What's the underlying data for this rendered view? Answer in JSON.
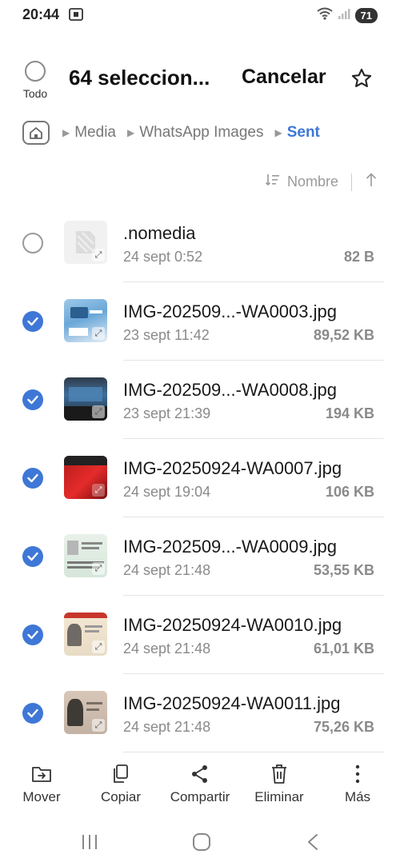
{
  "status_bar": {
    "time": "20:44",
    "battery": "71"
  },
  "header": {
    "select_all_label": "Todo",
    "title": "64 seleccion...",
    "cancel_label": "Cancelar"
  },
  "breadcrumb": {
    "items": [
      "Media",
      "WhatsApp Images",
      "Sent"
    ]
  },
  "sort": {
    "label": "Nombre"
  },
  "files": [
    {
      "name": ".nomedia",
      "date": "24 sept 0:52",
      "size": "82 B",
      "checked": false,
      "thumb": "file"
    },
    {
      "name": "IMG-202509...-WA0003.jpg",
      "date": "23 sept 11:42",
      "size": "89,52 KB",
      "checked": true,
      "thumb": "photo-blue"
    },
    {
      "name": "IMG-202509...-WA0008.jpg",
      "date": "23 sept 21:39",
      "size": "194 KB",
      "checked": true,
      "thumb": "photo-dark"
    },
    {
      "name": "IMG-20250924-WA0007.jpg",
      "date": "24 sept 19:04",
      "size": "106 KB",
      "checked": true,
      "thumb": "photo-red"
    },
    {
      "name": "IMG-202509...-WA0009.jpg",
      "date": "24 sept 21:48",
      "size": "53,55 KB",
      "checked": true,
      "thumb": "photo-id"
    },
    {
      "name": "IMG-20250924-WA0010.jpg",
      "date": "24 sept 21:48",
      "size": "61,01 KB",
      "checked": true,
      "thumb": "photo-dni"
    },
    {
      "name": "IMG-20250924-WA0011.jpg",
      "date": "24 sept 21:48",
      "size": "75,26 KB",
      "checked": true,
      "thumb": "photo-dni2"
    }
  ],
  "toolbar": {
    "move_label": "Mover",
    "copy_label": "Copiar",
    "share_label": "Compartir",
    "delete_label": "Eliminar",
    "more_label": "Más"
  },
  "colors": {
    "accent": "#3e77d6"
  }
}
